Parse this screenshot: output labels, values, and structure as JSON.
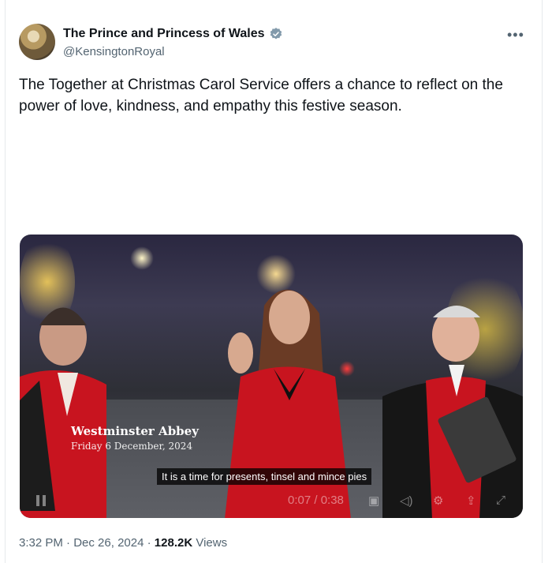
{
  "account": {
    "display_name": "The Prince and Princess of Wales",
    "handle": "@KensingtonRoyal",
    "verified": true,
    "verified_color": "#829aab"
  },
  "more_icon": "more-horizontal-icon",
  "tweet": {
    "text": "The Together at Christmas Carol Service offers a chance to reflect on the power of love, kindness, and empathy this festive season."
  },
  "video": {
    "location_title": "Westminster Abbey",
    "location_date": "Friday 6 December, 2024",
    "subtitle": "It is a time for presents, tinsel and mince pies",
    "time_display": "0:07 / 0:38",
    "progress": 0.184
  },
  "meta": {
    "time": "3:32 PM",
    "separator": "·",
    "date": "Dec 26, 2024",
    "views_count": "128.2K",
    "views_label": "Views"
  }
}
